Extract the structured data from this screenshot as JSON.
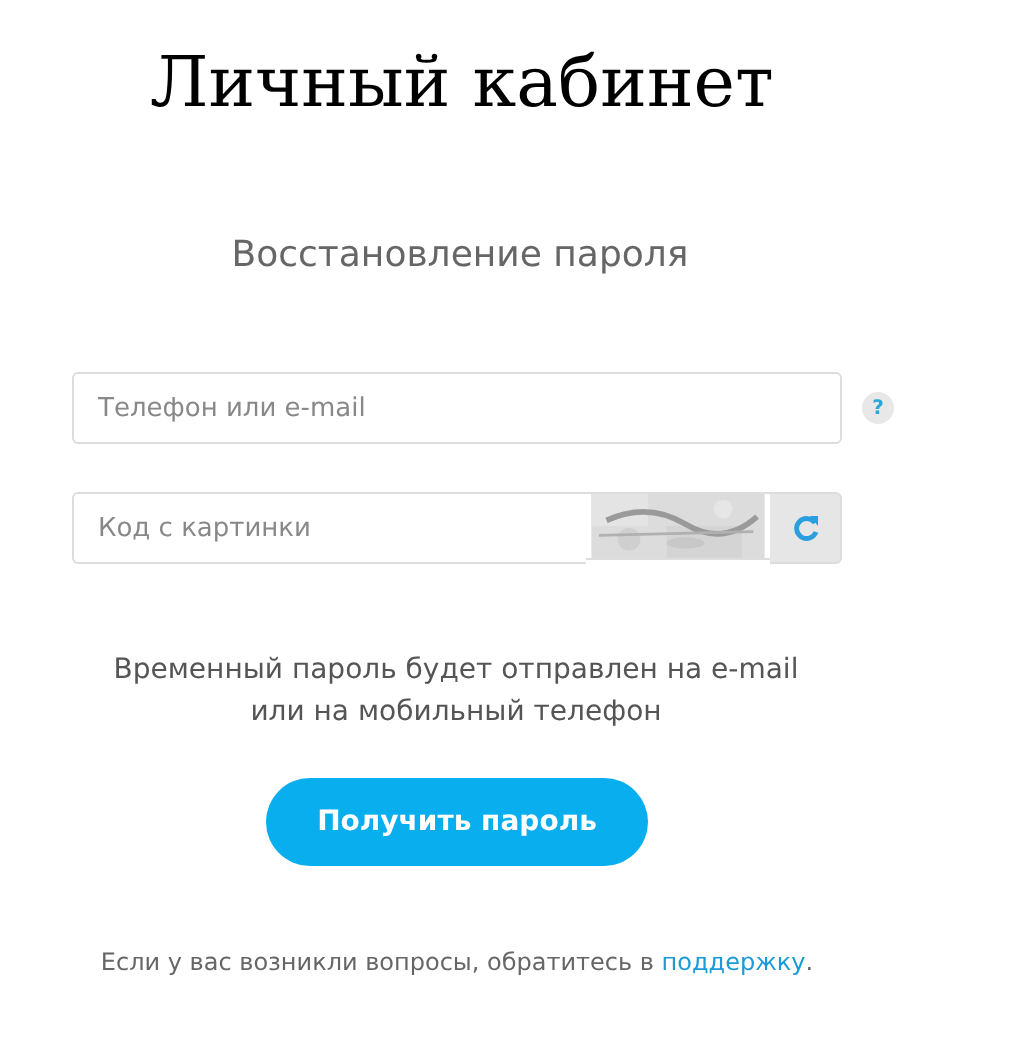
{
  "header": {
    "title": "Личный кабинет"
  },
  "form": {
    "title": "Восстановление пароля",
    "contact_field": {
      "placeholder": "Телефон или e-mail",
      "help": "?"
    },
    "captcha_field": {
      "placeholder": "Код с картинки"
    },
    "note_lines": [
      "Временный пароль будет отправлен на e-mail",
      "или на мобильный телефон"
    ],
    "submit_button": "Получить пароль"
  },
  "footer": {
    "text": "Если у вас возникли вопросы, обратитесь в ",
    "link": "поддержку",
    "after": "."
  }
}
